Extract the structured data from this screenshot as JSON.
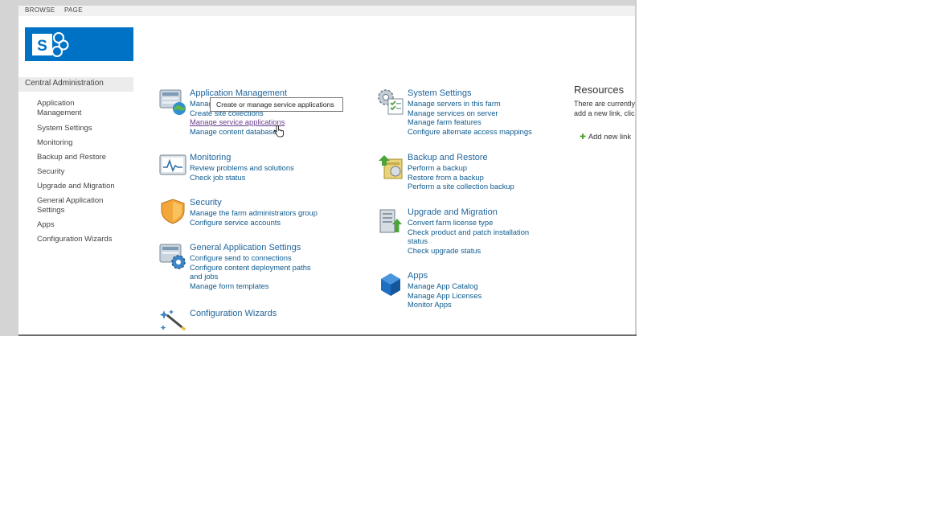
{
  "ribbon": {
    "tabs": [
      "BROWSE",
      "PAGE"
    ]
  },
  "logo": {
    "letter": "S"
  },
  "quick_launch": {
    "header": "Central Administration",
    "items": [
      "Application\nManagement",
      "System Settings",
      "Monitoring",
      "Backup and Restore",
      "Security",
      "Upgrade and Migration",
      "General Application\nSettings",
      "Apps",
      "Configuration Wizards"
    ]
  },
  "categories": {
    "app_management": {
      "title": "Application Management",
      "links": [
        "Manage web applications",
        "Create site collections",
        "Manage service applications",
        "Manage content databases"
      ]
    },
    "system_settings": {
      "title": "System Settings",
      "links": [
        "Manage servers in this farm",
        "Manage services on server",
        "Manage farm features",
        "Configure alternate access mappings"
      ]
    },
    "monitoring": {
      "title": "Monitoring",
      "links": [
        "Review problems and solutions",
        "Check job status"
      ]
    },
    "backup_restore": {
      "title": "Backup and Restore",
      "links": [
        "Perform a backup",
        "Restore from a backup",
        "Perform a site collection backup"
      ]
    },
    "security": {
      "title": "Security",
      "links": [
        "Manage the farm administrators group",
        "Configure service accounts"
      ]
    },
    "upgrade_migration": {
      "title": "Upgrade and Migration",
      "links": [
        "Convert farm license type",
        "Check product and patch installation",
        "status",
        "Check upgrade status"
      ]
    },
    "general_settings": {
      "title": "General Application Settings",
      "links": [
        "Configure send to connections",
        "Configure content deployment paths",
        "and jobs",
        "Manage form templates"
      ]
    },
    "apps": {
      "title": "Apps",
      "links": [
        "Manage App Catalog",
        "Manage App Licenses",
        "Monitor Apps"
      ]
    },
    "config_wizards": {
      "title": "Configuration Wizards"
    }
  },
  "tooltip": {
    "text": "Create or manage service applications"
  },
  "resources": {
    "title": "Resources",
    "text_line1": "There are currently",
    "text_line2": "add a new link, click",
    "add_link": "Add new link"
  },
  "colors": {
    "brand": "#0072c6",
    "link": "#0f5c8f",
    "title": "#22659c",
    "visited": "#6a3f90"
  }
}
